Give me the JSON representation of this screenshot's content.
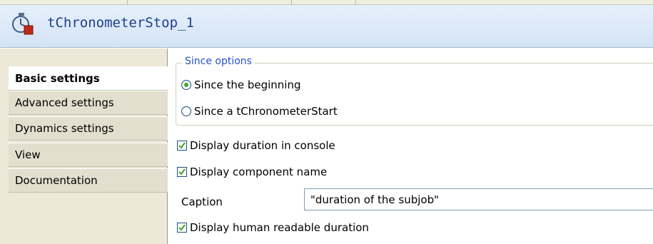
{
  "header": {
    "title": "tChronometerStop_1",
    "icon": "stopwatch-icon"
  },
  "sidebar": {
    "items": [
      {
        "label": "Basic settings",
        "active": true
      },
      {
        "label": "Advanced settings",
        "active": false
      },
      {
        "label": "Dynamics settings",
        "active": false
      },
      {
        "label": "View",
        "active": false
      },
      {
        "label": "Documentation",
        "active": false
      }
    ]
  },
  "main": {
    "since_options": {
      "legend": "Since options",
      "options": [
        {
          "label": "Since the beginning",
          "selected": true
        },
        {
          "label": "Since a tChronometerStart",
          "selected": false
        }
      ]
    },
    "display_duration": {
      "label": "Display duration in console",
      "checked": true
    },
    "display_component_name": {
      "label": "Display component name",
      "checked": true
    },
    "caption": {
      "label": "Caption",
      "value": "\"duration of the subjob\""
    },
    "display_human_readable": {
      "label": "Display human readable duration",
      "checked": true
    }
  },
  "colors": {
    "accent": "#2652c7",
    "check": "#3ea628",
    "header_title": "#1e3f8a"
  }
}
